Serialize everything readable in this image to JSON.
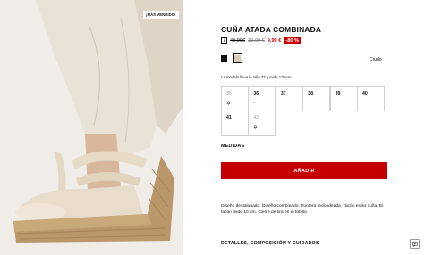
{
  "product": {
    "badge": "¡MÁS VENDIDO!",
    "title": "CUÑA ATADA COMBINADA",
    "info_icon": "i",
    "price_original": "49,99€",
    "price_previous": "39,99 €",
    "price_current": "9,99 €",
    "discount": "-80 %",
    "color_selected": "Crudo",
    "colors": [
      {
        "name": "black",
        "hex": "#111111"
      },
      {
        "name": "crudo",
        "hex": "#d9cbb8"
      }
    ],
    "model_note": "La modelo lleva la talla 37 y mide 1'76cm.",
    "sizes_row1": [
      {
        "label": "35",
        "sub": "🔔"
      },
      {
        "label": "36",
        "sub": "•"
      },
      {
        "label": "37",
        "sub": ""
      },
      {
        "label": "38",
        "sub": ""
      },
      {
        "label": "39",
        "sub": ""
      },
      {
        "label": "40",
        "sub": ""
      }
    ],
    "sizes_row2": [
      {
        "label": "41",
        "sub": ""
      },
      {
        "label": "42",
        "sub": "🔔"
      }
    ],
    "medidas": "MEDIDAS",
    "add_button": "AÑADIR",
    "description": "Diseño destalonado. Diseño combinado. Puntera redondeada. Tacón estilo cuña. El tacón mide 10 cm. Cierre de tira en el tobillo",
    "details": "DETALLES, COMPOSICIÓN Y CUIDADOS"
  },
  "colors": {
    "accent": "#c60000",
    "discount_bg": "#cc0000"
  },
  "icons": {
    "chat": "chat-icon",
    "info": "info-icon",
    "bell": "bell-icon"
  }
}
